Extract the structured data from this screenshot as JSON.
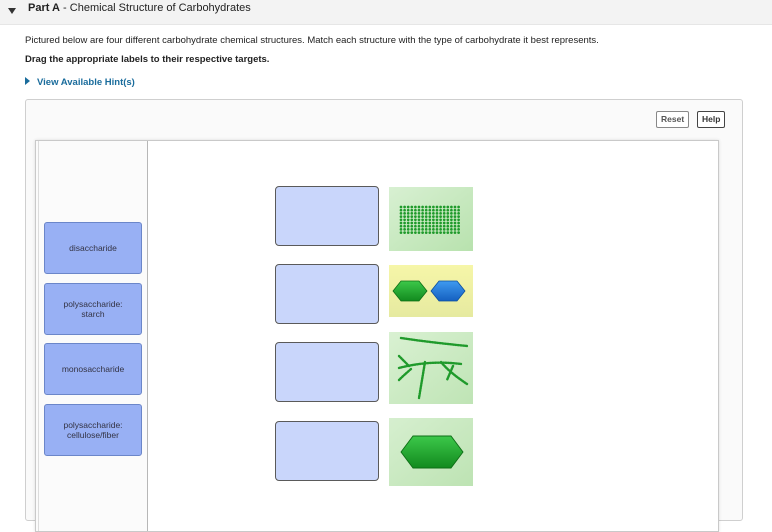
{
  "part": {
    "label": "Part A",
    "separator": " - ",
    "title": "Chemical Structure of Carbohydrates"
  },
  "instructions": "Pictured below are four different carbohydrate chemical structures. Match each structure with the type of carbohydrate it best represents.",
  "drag_instruction": "Drag the appropriate labels to their respective targets.",
  "hint_link": "View Available Hint(s)",
  "buttons": {
    "reset": "Reset",
    "help": "Help"
  },
  "labels": [
    {
      "line1": "disaccharide",
      "line2": ""
    },
    {
      "line1": "polysaccharide:",
      "line2": "starch"
    },
    {
      "line1": "monosaccharide",
      "line2": ""
    },
    {
      "line1": "polysaccharide:",
      "line2": "cellulose/fiber"
    }
  ],
  "structures": [
    {
      "icon": "cellulose-rows-icon"
    },
    {
      "icon": "disaccharide-hexagons-icon"
    },
    {
      "icon": "branched-starch-icon"
    },
    {
      "icon": "monosaccharide-hexagon-icon"
    }
  ],
  "colors": {
    "label_tile": "#98b0f4",
    "target": "#c9d6fb",
    "hint_link": "#1a6c9c",
    "glucose_green": "#1f9a2b",
    "hexagon_blue": "#1f7ad6"
  }
}
